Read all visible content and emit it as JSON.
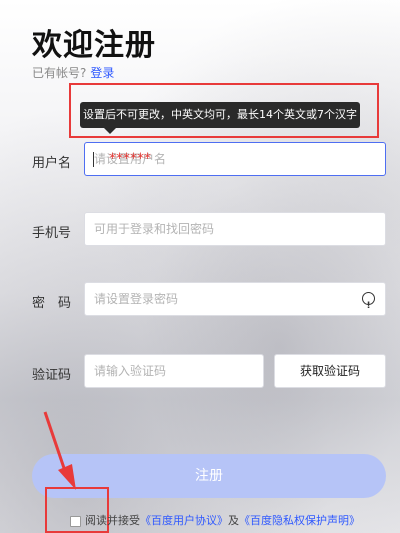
{
  "header": {
    "title": "欢迎注册",
    "login_prompt": "已有帐号?",
    "login_link": "登录"
  },
  "tooltip": {
    "text": "设置后不可更改，中英文均可，最长14个英文或7个汉字"
  },
  "form": {
    "username": {
      "label": "用户名",
      "placeholder": "请设置用户名",
      "value_masked": "******"
    },
    "phone": {
      "label": "手机号",
      "placeholder": "可用于登录和找回密码"
    },
    "password": {
      "label": "密　码",
      "placeholder": "请设置登录密码"
    },
    "code": {
      "label": "验证码",
      "placeholder": "请输入验证码",
      "button_label": "获取验证码"
    }
  },
  "register_button": "注册",
  "agreement": {
    "prefix": "阅读并接受",
    "link1": "《百度用户协议》",
    "middle": "及",
    "link2": "《百度隐私权保护声明》"
  },
  "colors": {
    "link": "#2e58ff",
    "annotation": "#e83a3a",
    "register_button": "#b6c4f7"
  }
}
